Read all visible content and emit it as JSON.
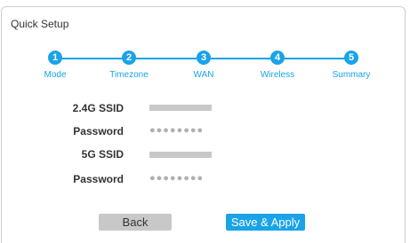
{
  "panel": {
    "title": "Quick Setup"
  },
  "steps": [
    {
      "number": "1",
      "label": "Mode"
    },
    {
      "number": "2",
      "label": "Timezone"
    },
    {
      "number": "3",
      "label": "WAN"
    },
    {
      "number": "4",
      "label": "Wireless"
    },
    {
      "number": "5",
      "label": "Summary"
    }
  ],
  "summary": {
    "ssid_24_label": "2.4G SSID",
    "password_24_label": "Password",
    "password_24_value": "●●●●●●●●",
    "ssid_5_label": "5G SSID",
    "password_5_label": "Password",
    "password_5_value": "●●●●●●●●"
  },
  "buttons": {
    "back": "Back",
    "save_apply": "Save & Apply"
  },
  "colors": {
    "accent": "#1aa3e8",
    "button_gray": "#c8c8c8",
    "border": "#cfcfcf"
  }
}
